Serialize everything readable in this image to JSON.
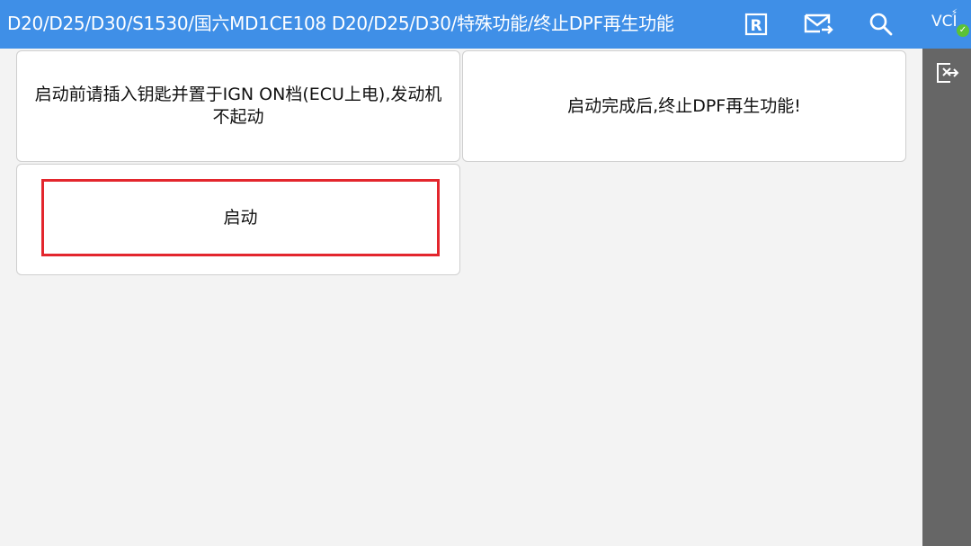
{
  "header": {
    "breadcrumb": "D20/D25/D30/S1530/国六MD1CE108 D20/D25/D30/特殊功能/终止DPF再生功能",
    "r_button_label": "R"
  },
  "side": {
    "vci_label": "VCI",
    "vci_status": "connected"
  },
  "cards": {
    "instruction": "启动前请插入钥匙并置于IGN ON档(ECU上电),发动机不起动",
    "result": "启动完成后,终止DPF再生功能!",
    "start_label": "启动"
  },
  "colors": {
    "header_bg": "#3f8fe7",
    "side_bg": "#666666",
    "highlight_border": "#e3262d",
    "status_ok": "#5bc236"
  }
}
